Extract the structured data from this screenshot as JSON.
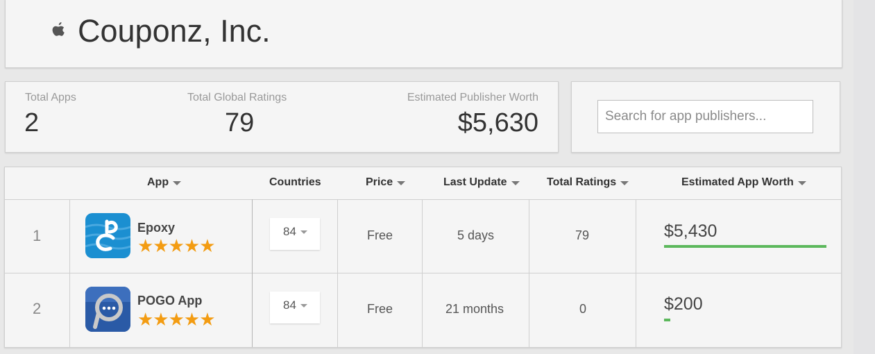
{
  "publisher": {
    "title": "Couponz, Inc.",
    "platform_icon": "apple-icon"
  },
  "stats": {
    "total_apps_label": "Total Apps",
    "total_apps": "2",
    "total_ratings_label": "Total Global Ratings",
    "total_ratings": "79",
    "worth_label": "Estimated Publisher Worth",
    "worth": "$5,630"
  },
  "search": {
    "placeholder": "Search for app publishers...",
    "value": ""
  },
  "table": {
    "headers": {
      "app": "App",
      "countries": "Countries",
      "price": "Price",
      "last_update": "Last Update",
      "total_ratings": "Total Ratings",
      "worth": "Estimated App Worth"
    },
    "rows": [
      {
        "rank": "1",
        "name": "Epoxy",
        "stars": "★★★★★",
        "rating_stars": 5,
        "countries": "84",
        "price": "Free",
        "last_update": "5 days",
        "total_ratings": "79",
        "worth": "$5,430",
        "worth_share": 1.0,
        "icon": "epoxy-app-icon"
      },
      {
        "rank": "2",
        "name": "POGO App",
        "stars": "★★★★★",
        "rating_stars": 5,
        "countries": "84",
        "price": "Free",
        "last_update": "21 months",
        "total_ratings": "0",
        "worth": "$200",
        "worth_share": 0.037,
        "icon": "pogo-app-icon"
      }
    ]
  },
  "colors": {
    "star": "#f39c12",
    "worth_bar": "#5cb85c"
  }
}
